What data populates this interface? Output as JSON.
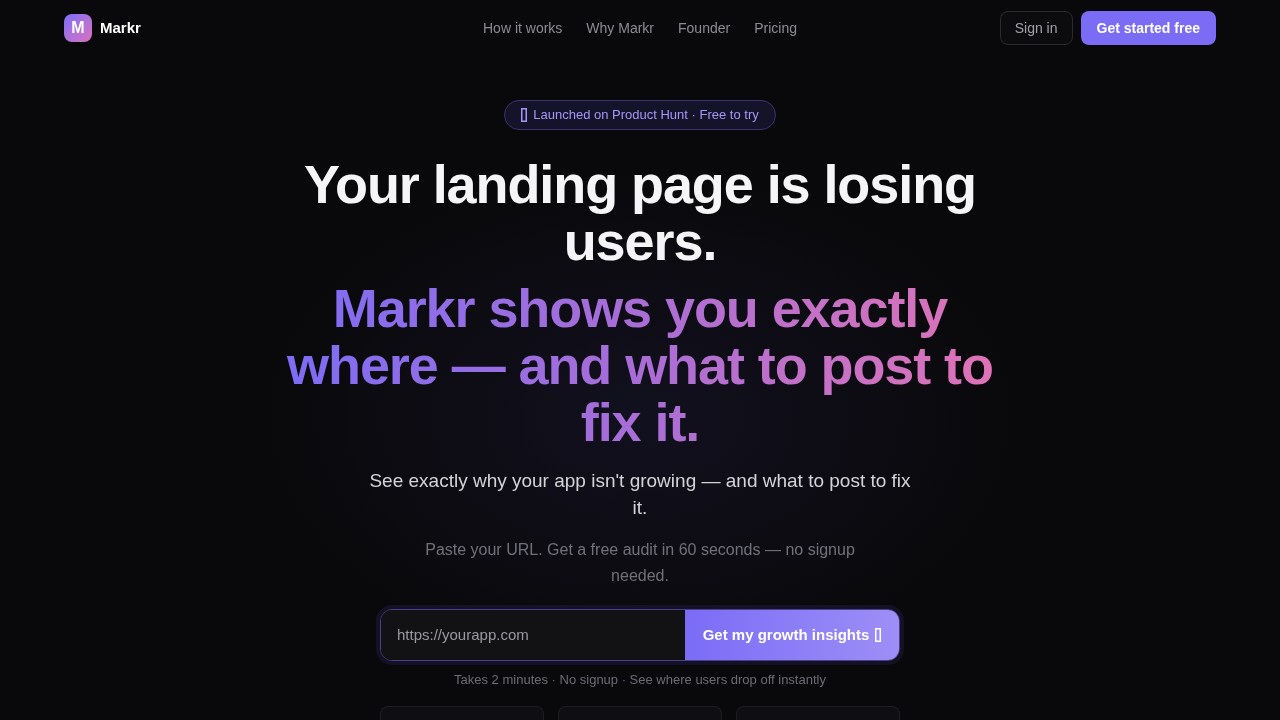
{
  "nav": {
    "logo": {
      "mark": "M",
      "name": "Markr"
    },
    "links": [
      "How it works",
      "Why Markr",
      "Founder",
      "Pricing"
    ],
    "buttons": [
      {
        "label": "Sign in",
        "kind": "outline"
      },
      {
        "label": "Get started free",
        "kind": "primary"
      }
    ]
  },
  "hero": {
    "badge": "Launched on Product Hunt · Free to try",
    "headline": "Your landing page is losing users.",
    "headline_accent": "Markr shows you exactly where — and what to post to fix it.",
    "subtitle": "See exactly why your app isn't growing — and what to post to fix it.",
    "note": "Paste your URL. Get a free audit in 60 seconds — no signup needed.",
    "url_form": {
      "placeholder": "https://yourapp.com",
      "button": "Get my growth insights"
    },
    "caption": "Takes 2 minutes · No signup · See where users drop off instantly"
  },
  "step_cards": [
    {
      "kind": "card"
    },
    {
      "kind": "card"
    },
    {
      "kind": "card"
    }
  ]
}
